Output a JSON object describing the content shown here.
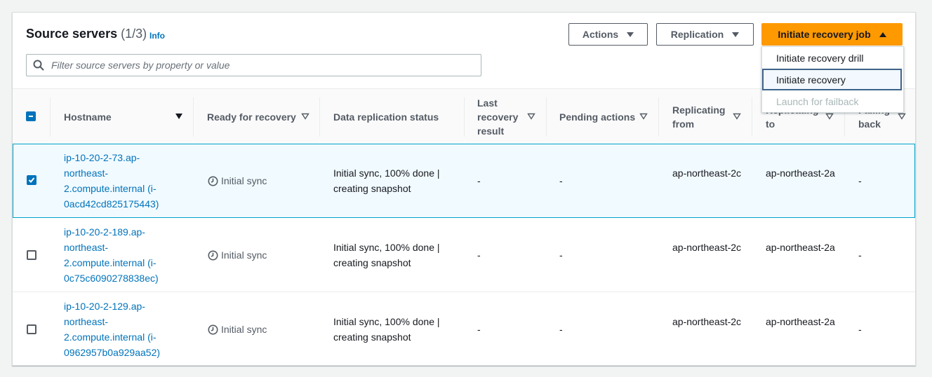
{
  "header": {
    "title": "Source servers",
    "count": "(1/3)",
    "info": "Info"
  },
  "buttons": {
    "actions": "Actions",
    "replication": "Replication",
    "initiate": "Initiate recovery job"
  },
  "search": {
    "placeholder": "Filter source servers by property or value"
  },
  "columns": [
    "Hostname",
    "Ready for recovery",
    "Data replication status",
    "Last\nrecovery\nresult",
    "Pending actions",
    "Replicating\nfrom",
    "Replicating\nto",
    "Failing\nback"
  ],
  "rows": [
    {
      "hostname": "ip-10-20-2-73.ap-northeast-2.compute.internal (i-0acd42cd825175443)",
      "ready": "Initial sync",
      "replication": "Initial sync, 100% done | creating snapshot",
      "last_result": "-",
      "pending": "-",
      "from": "ap-northeast-2c",
      "to": "ap-northeast-2a",
      "failing_back": "-",
      "selected": true
    },
    {
      "hostname": "ip-10-20-2-189.ap-northeast-2.compute.internal (i-0c75c6090278838ec)",
      "ready": "Initial sync",
      "replication": "Initial sync, 100% done | creating snapshot",
      "last_result": "-",
      "pending": "-",
      "from": "ap-northeast-2c",
      "to": "ap-northeast-2a",
      "failing_back": "-",
      "selected": false
    },
    {
      "hostname": "ip-10-20-2-129.ap-northeast-2.compute.internal (i-0962957b0a929aa52)",
      "ready": "Initial sync",
      "replication": "Initial sync, 100% done | creating snapshot",
      "last_result": "-",
      "pending": "-",
      "from": "ap-northeast-2c",
      "to": "ap-northeast-2a",
      "failing_back": "-",
      "selected": false
    }
  ],
  "dropdown": {
    "items": [
      {
        "label": "Initiate recovery drill",
        "state": "normal"
      },
      {
        "label": "Initiate recovery",
        "state": "focused"
      },
      {
        "label": "Launch for failback",
        "state": "disabled"
      }
    ]
  },
  "colors": {
    "primary": "#ff9900",
    "link": "#0073bb",
    "selection_border": "#00a1c9"
  }
}
